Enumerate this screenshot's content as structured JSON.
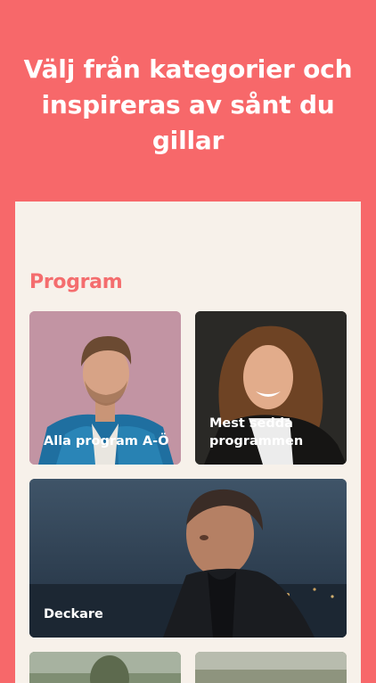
{
  "promo": {
    "headline_line1": "Välj från kategorier och",
    "headline_line2": "inspireras av sånt du",
    "headline_line3": "gillar"
  },
  "screen": {
    "section_title": "Program",
    "cards": [
      {
        "label": "Alla program A-Ö"
      },
      {
        "label_line1": "Mest sedda",
        "label_line2": "programmen"
      },
      {
        "label": "Deckare"
      }
    ]
  },
  "colors": {
    "background": "#f7686a",
    "screen_bg": "#f7f1ea",
    "section_title": "#f46d6e"
  }
}
